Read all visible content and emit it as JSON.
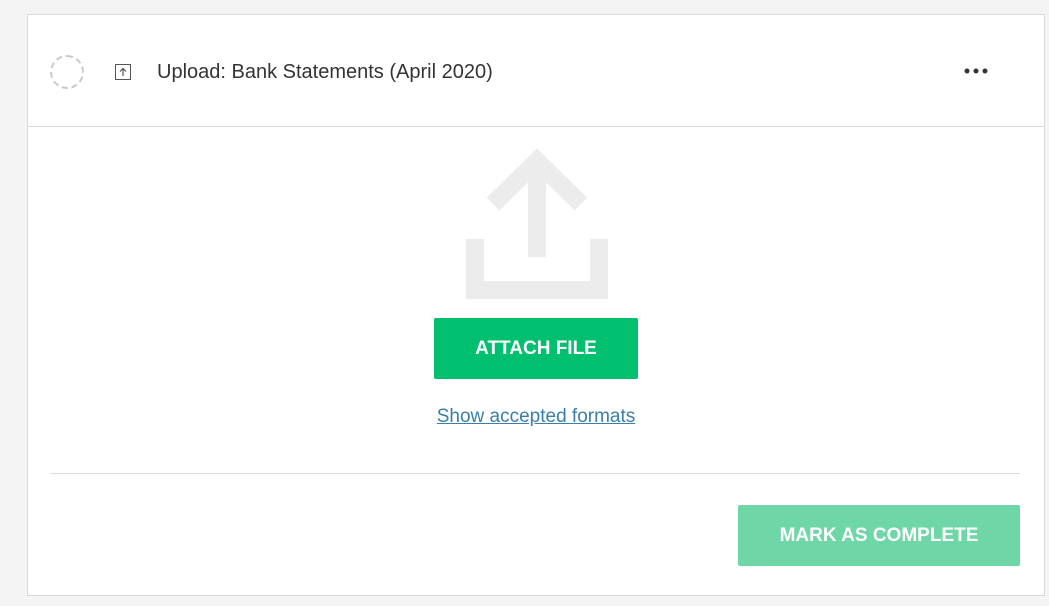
{
  "task": {
    "title": "Upload: Bank Statements (April 2020)",
    "type_icon": "upload-arrow-icon",
    "status_icon": "incomplete-dashed-circle-icon",
    "more_label": "•••"
  },
  "upload": {
    "graphic_icon": "upload-tray-icon",
    "attach_label": "ATTACH FILE",
    "formats_link": "Show accepted formats"
  },
  "footer": {
    "complete_label": "MARK AS COMPLETE"
  },
  "colors": {
    "attach_button": "#00bf6f",
    "complete_button": "#6fd6a8",
    "link": "#3a7fa8",
    "upload_graphic": "#ececec"
  }
}
